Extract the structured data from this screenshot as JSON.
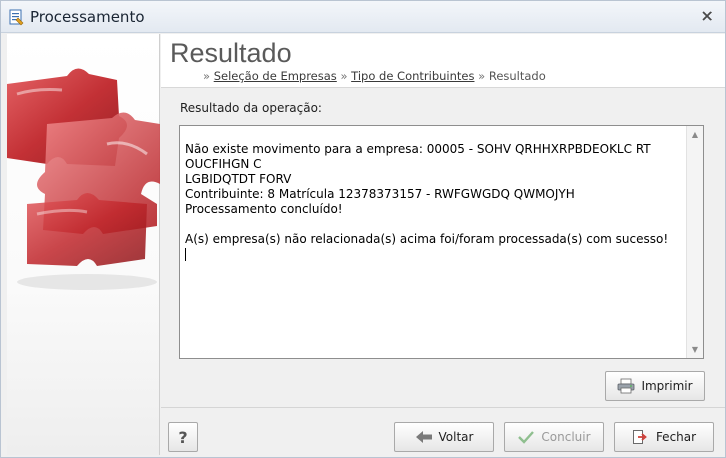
{
  "window": {
    "title": "Processamento",
    "close_icon": "close-x-icon"
  },
  "header": {
    "title": "Resultado",
    "breadcrumb": {
      "prefix": "»",
      "step1": "Seleção de Empresas",
      "sep1": "»",
      "step2": "Tipo de Contribuintes",
      "sep2": "»",
      "current": "Resultado"
    }
  },
  "result": {
    "label": "Resultado da operação:",
    "lines": [
      "Não existe movimento para a empresa: 00005 - SOHV QRHHXRPBDEOKLC RT OUCFIHGN C",
      "LGBIDQTDT FORV",
      "Contribuinte: 8 Matrícula 12378373157 - RWFGWGDQ QWMOJYH",
      "Processamento concluído!",
      "",
      "A(s) empresa(s) não relacionada(s) acima foi/foram processada(s) com sucesso!"
    ]
  },
  "buttons": {
    "print_label": "Imprimir",
    "help_label": "?",
    "back_label": "Voltar",
    "finish_label": "Concluir",
    "close_label": "Fechar"
  },
  "colors": {
    "accent_red": "#c0262b",
    "title_gray": "#5a5a5a",
    "arrow_gray": "#7a7a7a",
    "check_green": "#8fbf8f",
    "exit_red": "#d0403a"
  }
}
